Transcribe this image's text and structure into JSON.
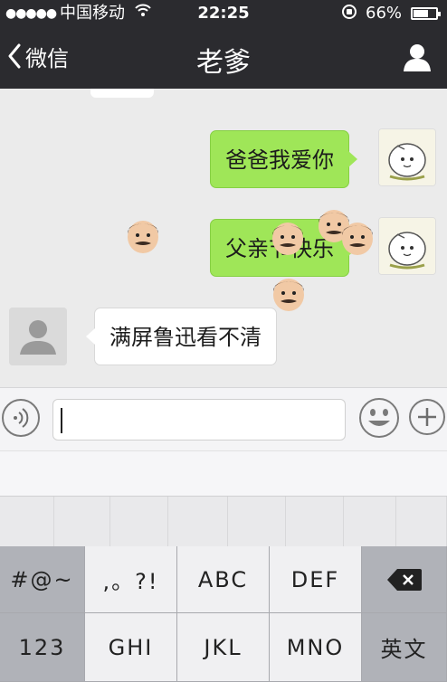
{
  "status_bar": {
    "signal": "●●●●●",
    "carrier": "中国移动",
    "wifi_icon": "wifi-icon",
    "time": "22:25",
    "battery_percent": "66%",
    "battery_level": 0.66
  },
  "nav": {
    "back_label": "微信",
    "title": "老爹",
    "profile_icon": "person-icon"
  },
  "messages": [
    {
      "from": "self",
      "text": "爸爸我爱你"
    },
    {
      "from": "self",
      "text": "父亲节快乐"
    },
    {
      "from": "other",
      "text": "满屏鲁迅看不清"
    }
  ],
  "input": {
    "value": "",
    "voice_icon": "voice-icon",
    "emoji_icon": "smiley-icon",
    "plus_icon": "plus-icon"
  },
  "keyboard": {
    "row1": [
      "#@~",
      ",。?!",
      "ABC",
      "DEF"
    ],
    "row2": [
      "123",
      "GHI",
      "JKL",
      "MNO",
      "英文"
    ],
    "backspace_icon": "backspace-icon"
  },
  "colors": {
    "nav_bg": "#2b2b2f",
    "chat_bg": "#ebebeb",
    "self_bubble": "#9fe658",
    "other_bubble": "#ffffff",
    "keyboard_bg": "#b8b9be"
  }
}
